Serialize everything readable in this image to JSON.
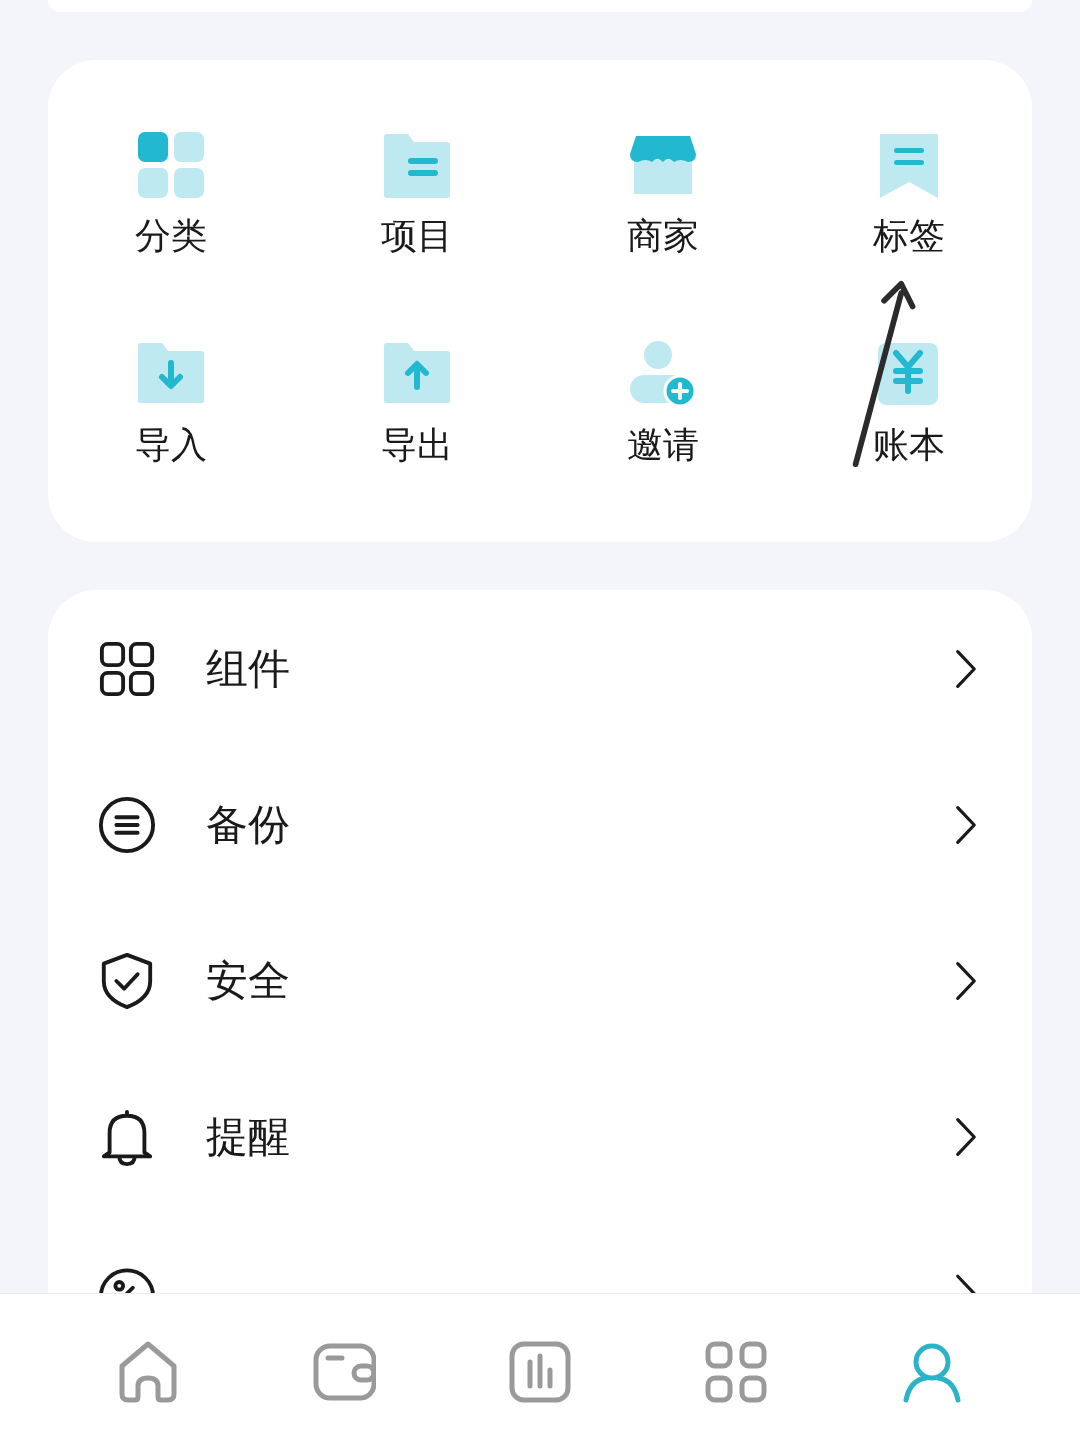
{
  "tools": [
    {
      "label": "分类"
    },
    {
      "label": "项目"
    },
    {
      "label": "商家"
    },
    {
      "label": "标签"
    },
    {
      "label": "导入"
    },
    {
      "label": "导出"
    },
    {
      "label": "邀请"
    },
    {
      "label": "账本"
    }
  ],
  "menu": [
    {
      "label": "组件"
    },
    {
      "label": "备份"
    },
    {
      "label": "安全"
    },
    {
      "label": "提醒"
    }
  ],
  "menu_peek_row": true,
  "nav": [
    {
      "selected": false
    },
    {
      "selected": false
    },
    {
      "selected": false
    },
    {
      "selected": false
    },
    {
      "selected": true
    }
  ]
}
